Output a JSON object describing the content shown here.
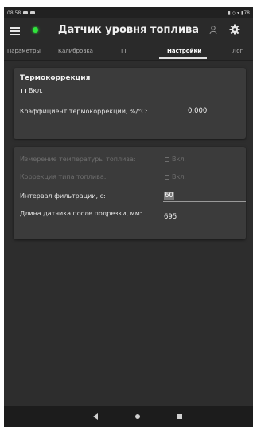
{
  "status_bar": {
    "time": "08:58",
    "indicators": "▮ ◇ ▾ ▮78"
  },
  "app_bar": {
    "title": "Датчик уровня топлива",
    "connection_color": "#30e23c"
  },
  "tabs": [
    {
      "label": "Параметры"
    },
    {
      "label": "Калибровка"
    },
    {
      "label": "ТТ"
    },
    {
      "label": "Настройки",
      "active": true
    },
    {
      "label": "Лог"
    }
  ],
  "thermo": {
    "title": "Термокоррекция",
    "enable_label": "Вкл.",
    "enable_checked": false,
    "coef_label": "Коэффициент термокоррекции, %/°С:",
    "coef_value": "0.000"
  },
  "settings": {
    "temp_measure_label": "Измерение температуры топлива:",
    "temp_measure_check": "Вкл.",
    "fuel_type_label": "Коррекция типа топлива:",
    "fuel_type_check": "Вкл.",
    "filter_label": "Интервал фильтрации, с:",
    "filter_value": "60",
    "length_label": "Длина датчика после подрезки, мм:",
    "length_value": "695"
  },
  "icons": [
    "menu-icon",
    "person-icon",
    "gear-icon",
    "back-icon",
    "home-icon",
    "recents-icon"
  ]
}
